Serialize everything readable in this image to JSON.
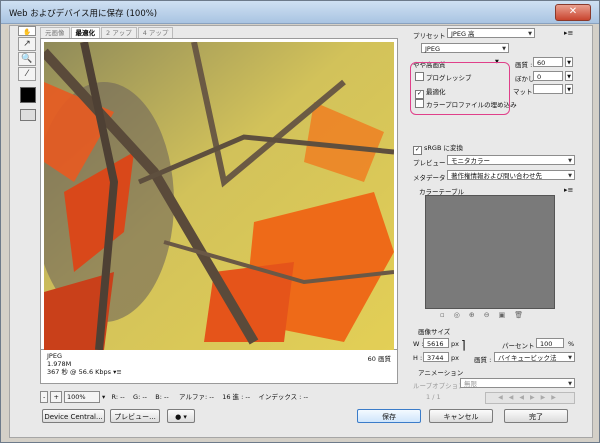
{
  "window": {
    "title": "Web およびデバイス用に保存 (100%)",
    "close": "✕"
  },
  "tabs": [
    "元画像",
    "最適化",
    "2 アップ",
    "4 アップ"
  ],
  "tools": [
    "hand-tool-icon",
    "slice-select-icon",
    "zoom-icon",
    "eyedropper-icon"
  ],
  "image_info": {
    "format": "JPEG",
    "size": "1.978M",
    "time": "367 秒 @ 56.6 Kbps",
    "menu": "▾≡",
    "quality": "60 画質"
  },
  "statusbar": {
    "zoom": "100%",
    "r": "R: --",
    "g": "G: --",
    "b": "B: --",
    "alpha": "アルファ: --",
    "hex": "16 進 : --",
    "index": "インデックス : --"
  },
  "panel": {
    "preset_label": "プリセット :",
    "preset_value": "JPEG 高",
    "format_value": "JPEG",
    "compression_value": "やや高画質",
    "quality_label": "画質 :",
    "quality_value": "60",
    "blur_label": "ぼかし :",
    "blur_value": "0",
    "matte_label": "マット :",
    "progressive_label": "プログレッシブ",
    "optimized_label": "最適化",
    "icc_label": "カラープロファイルの埋め込み",
    "srgb_label": "sRGB に変換",
    "preview_label": "プレビュー :",
    "preview_value": "モニタカラー",
    "metadata_label": "メタデータ :",
    "metadata_value": "著作権情報および問い合わせ先",
    "colortable_label": "カラーテーブル",
    "imagesize_label": "画像サイズ",
    "w_label": "W :",
    "w_value": "5616",
    "h_label": "H :",
    "h_value": "3744",
    "px": "px",
    "percent_label": "パーセント :",
    "percent_value": "100",
    "percent_unit": "%",
    "quality2_label": "画質 :",
    "quality2_value": "バイキュービック法",
    "animation_label": "アニメーション",
    "loop_label": "ループオプション :",
    "loop_value": "無限",
    "frame_counter": "1 / 1"
  },
  "buttons": {
    "device_central": "Device Central...",
    "preview": "プレビュー...",
    "save": "保存",
    "cancel": "キャンセル",
    "done": "完了"
  },
  "colors": {
    "highlight": "#e0408a",
    "accent": "#3b7cc9"
  }
}
